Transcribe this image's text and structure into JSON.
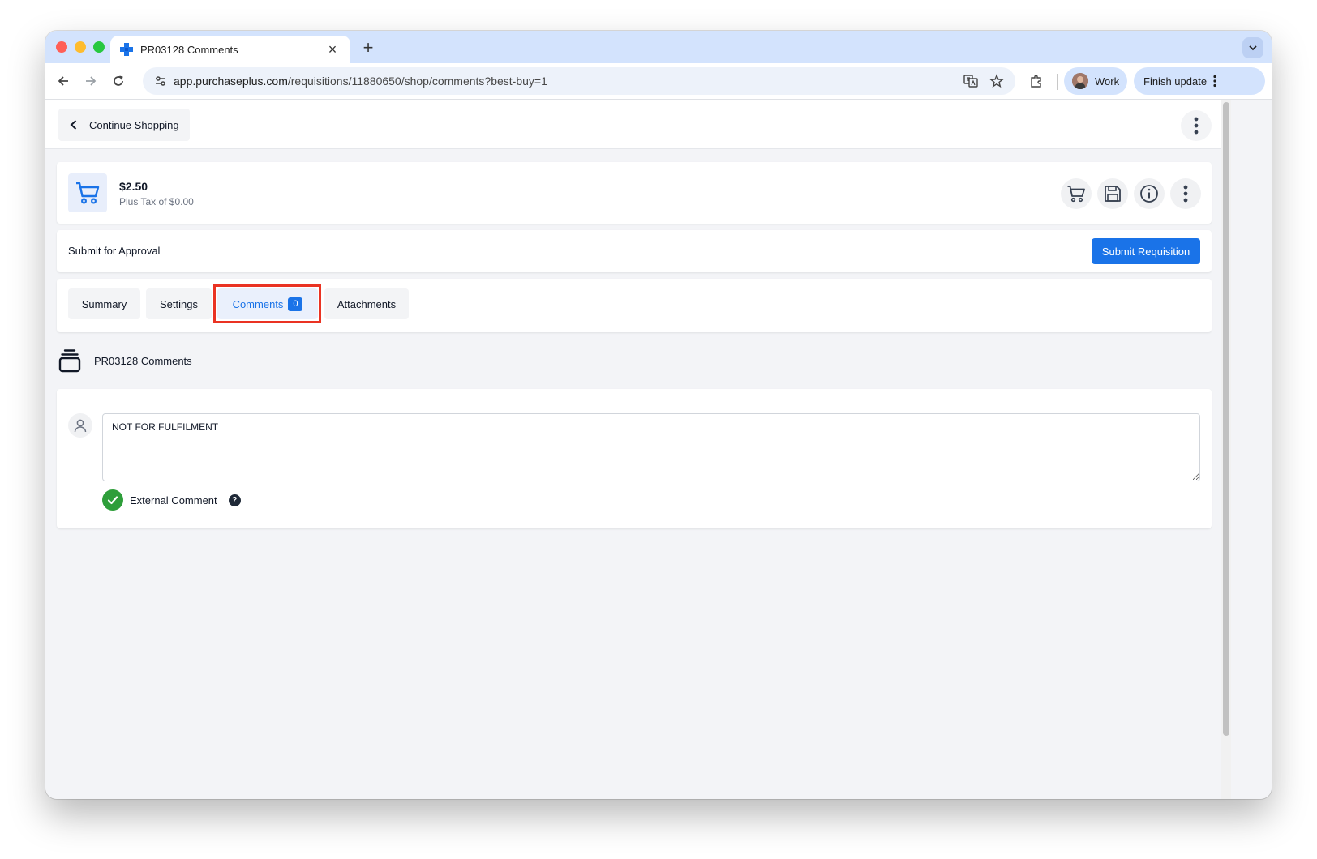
{
  "browser": {
    "tab_title": "PR03128 Comments",
    "url_host": "app.purchaseplus.com",
    "url_path": "/requisitions/11880650/shop/comments?best-buy=1",
    "profile_label": "Work",
    "update_label": "Finish update"
  },
  "header": {
    "continue_label": "Continue Shopping"
  },
  "requisition": {
    "total": "$2.50",
    "tax": "Plus Tax of $0.00"
  },
  "approval": {
    "label": "Submit for Approval",
    "submit_label": "Submit Requisition"
  },
  "tabs": [
    {
      "label": "Summary"
    },
    {
      "label": "Settings"
    },
    {
      "label": "Comments",
      "count": "0",
      "active": true
    },
    {
      "label": "Attachments"
    }
  ],
  "comments": {
    "heading": "PR03128 Comments",
    "input_value": "NOT FOR FULFILMENT",
    "external_label": "External Comment",
    "help_glyph": "?"
  },
  "colors": {
    "accent": "#1a73e8",
    "highlight": "#ea3323",
    "success": "#2e9e3a"
  },
  "icons": {
    "cart": "cart-icon",
    "save": "save-icon",
    "info": "info-icon",
    "more": "more-vertical-icon",
    "comments": "stack-icon",
    "user": "user-icon",
    "check": "check-icon"
  }
}
